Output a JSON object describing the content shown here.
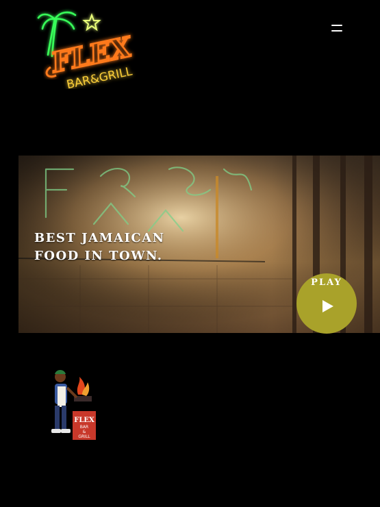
{
  "header": {
    "logo": {
      "name": "FLEX",
      "sub": "BAR&GRILL"
    },
    "menu_icon": "hamburger-menu-icon"
  },
  "hero": {
    "headline_line1": "BEST JAMAICAN",
    "headline_line2": "FOOD IN TOWN.",
    "play_label": "PLAY",
    "play_icon": "play-icon",
    "play_color": "#a9a22a"
  },
  "mascot": {
    "sign": "FLEX",
    "sub1": "BAR",
    "sub2": "&",
    "sub3": "GRILL"
  },
  "colors": {
    "neon_green": "#39ff5a",
    "neon_orange": "#ff7a1a",
    "neon_yellow": "#ffd23a",
    "background": "#000000"
  }
}
